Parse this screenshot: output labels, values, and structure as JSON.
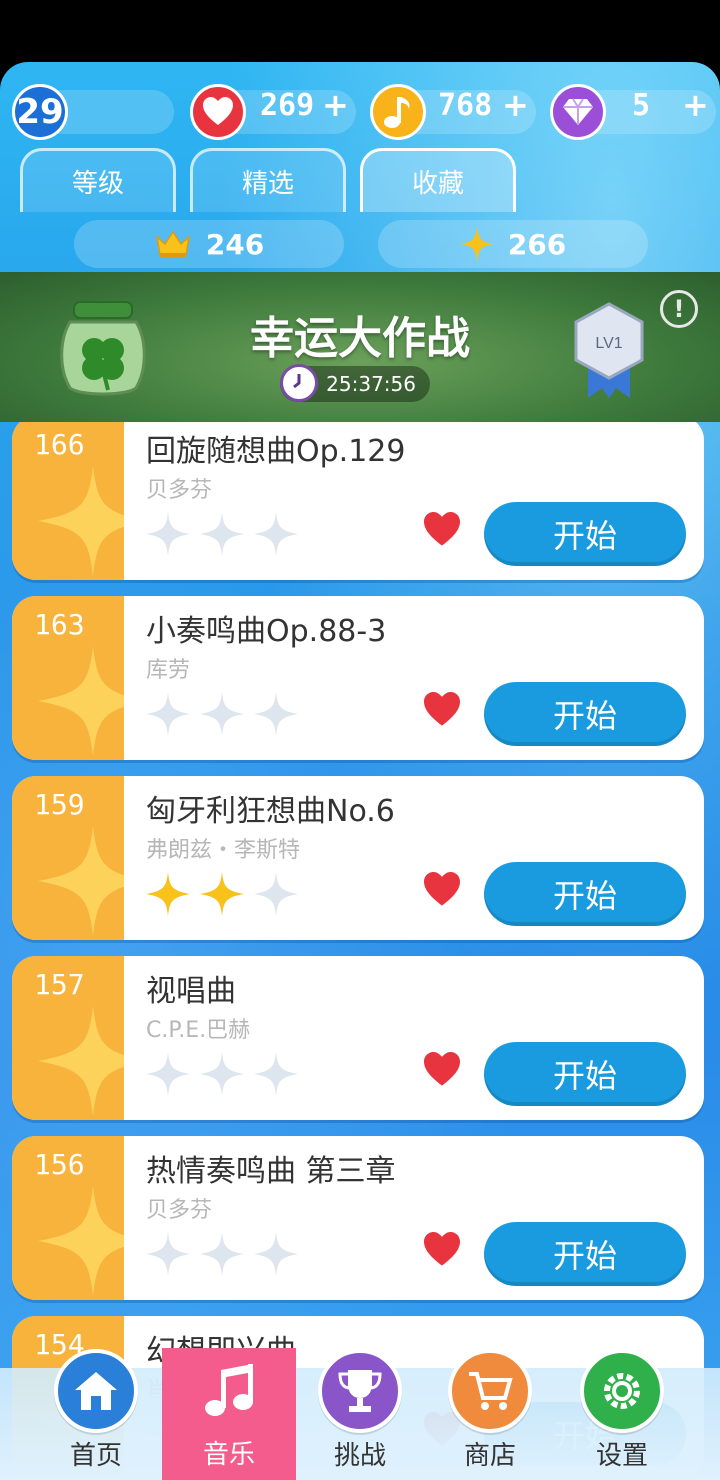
{
  "top_bar": {
    "level": "29",
    "hearts": {
      "value": "269",
      "plus": "+"
    },
    "notes": {
      "value": "768",
      "plus": "+"
    },
    "diamonds": {
      "value": "5",
      "plus": "+"
    }
  },
  "tabs": [
    {
      "label": "等级",
      "active": false
    },
    {
      "label": "精选",
      "active": false
    },
    {
      "label": "收藏",
      "active": true
    }
  ],
  "stats": {
    "crowns": "246",
    "stars": "266"
  },
  "banner": {
    "title": "幸运大作战",
    "timer": "25:37:56",
    "badge": "LV1",
    "info": "!"
  },
  "songs": [
    {
      "number": "166",
      "title": "回旋随想曲Op.129",
      "composer": "贝多芬",
      "stars_earned": 0,
      "favorite": true,
      "start_label": "开始"
    },
    {
      "number": "163",
      "title": "小奏鸣曲Op.88-3",
      "composer": "库劳",
      "stars_earned": 0,
      "favorite": true,
      "start_label": "开始"
    },
    {
      "number": "159",
      "title": "匈牙利狂想曲No.6",
      "composer": "弗朗兹・李斯特",
      "stars_earned": 2,
      "favorite": true,
      "start_label": "开始"
    },
    {
      "number": "157",
      "title": "视唱曲",
      "composer": "C.P.E.巴赫",
      "stars_earned": 0,
      "favorite": true,
      "start_label": "开始"
    },
    {
      "number": "156",
      "title": "热情奏鸣曲 第三章",
      "composer": "贝多芬",
      "stars_earned": 0,
      "favorite": true,
      "start_label": "开始"
    },
    {
      "number": "154",
      "title": "幻想即兴曲",
      "composer": "肖邦",
      "stars_earned": 0,
      "favorite": true,
      "start_label": "开始"
    }
  ],
  "nav": [
    {
      "label": "首页",
      "icon": "home-icon",
      "color": "#2a7fd8"
    },
    {
      "label": "音乐",
      "icon": "music-note-icon",
      "color": "#f45c8e"
    },
    {
      "label": "挑战",
      "icon": "trophy-icon",
      "color": "#8a55c8"
    },
    {
      "label": "商店",
      "icon": "cart-icon",
      "color": "#f08a3c"
    },
    {
      "label": "设置",
      "icon": "gear-icon",
      "color": "#2fb04a"
    }
  ],
  "colors": {
    "accent_blue": "#1a9be0",
    "card_side": "#f7b33c",
    "heart_red": "#e8343e",
    "star_gold": "#f8c21a",
    "star_empty": "#dde6ee"
  }
}
